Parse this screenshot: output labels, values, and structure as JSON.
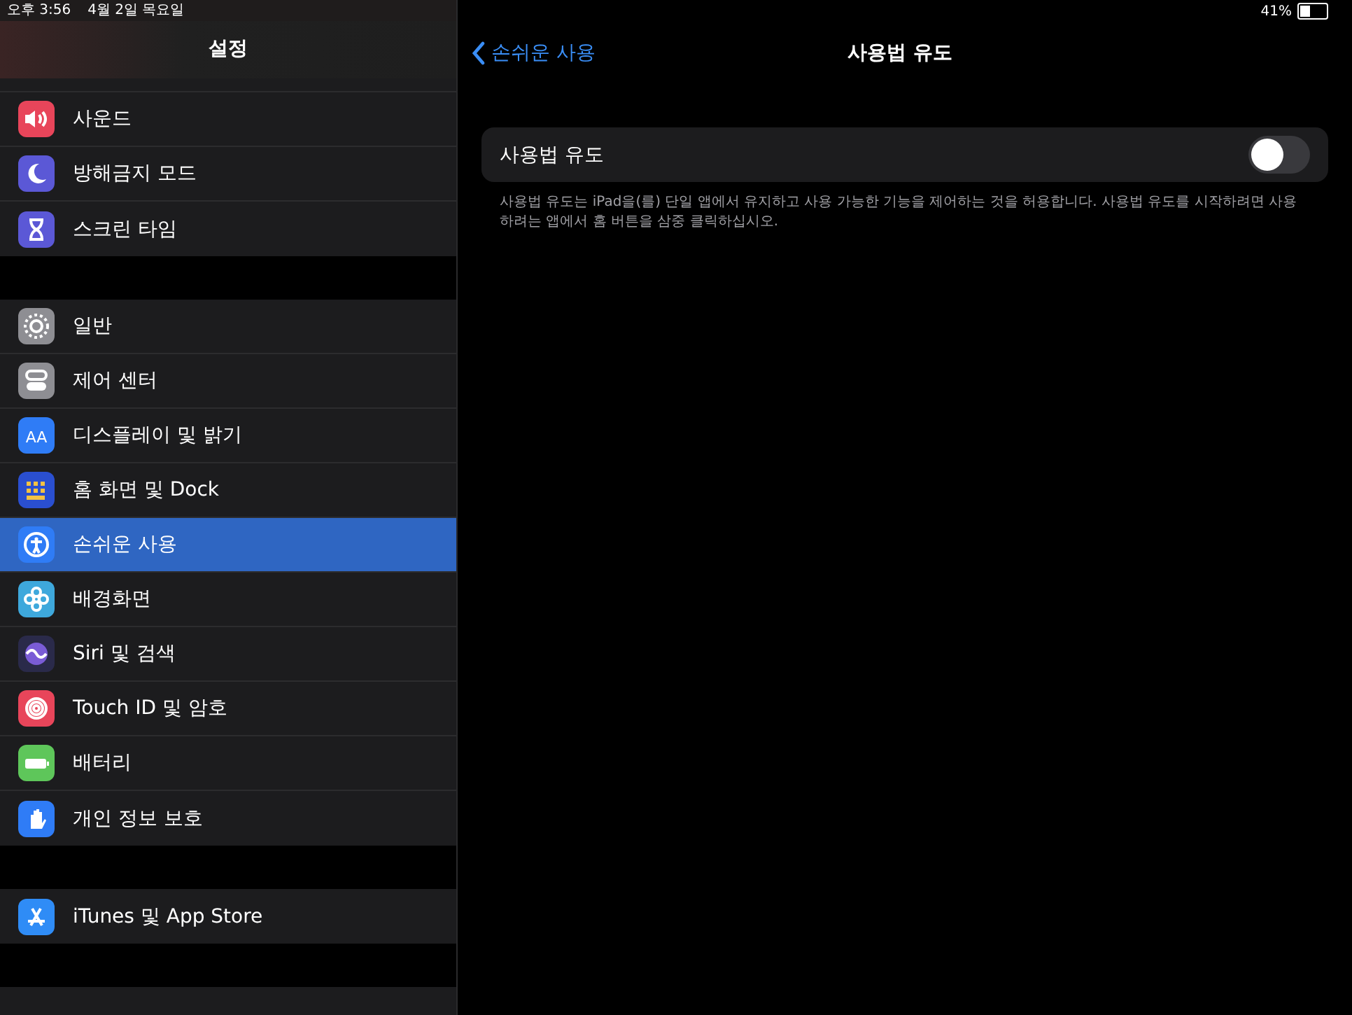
{
  "status_bar": {
    "time": "오후 3:56",
    "date": "4월 2일 목요일",
    "battery_percent": "41%"
  },
  "sidebar": {
    "title": "설정",
    "groups": [
      {
        "items": [
          {
            "label": "사운드",
            "color": "#e8455a",
            "selected": false
          },
          {
            "label": "방해금지 모드",
            "color": "#5b58d6",
            "selected": false
          },
          {
            "label": "스크린 타임",
            "color": "#5b58d6",
            "selected": false
          }
        ]
      },
      {
        "items": [
          {
            "label": "일반",
            "color": "#8e8e93",
            "selected": false
          },
          {
            "label": "제어 센터",
            "color": "#8e8e93",
            "selected": false
          },
          {
            "label": "디스플레이 및 밝기",
            "color": "#2f7cf6",
            "selected": false,
            "icon_text": "AA"
          },
          {
            "label": "홈 화면 및 Dock",
            "color": "#2a4fd0",
            "selected": false
          },
          {
            "label": "손쉬운 사용",
            "color": "#2f7cf6",
            "selected": true
          },
          {
            "label": "배경화면",
            "color": "#3ea8dc",
            "selected": false
          },
          {
            "label": "Siri 및 검색",
            "color": "#2a2a4a",
            "selected": false
          },
          {
            "label": "Touch ID 및 암호",
            "color": "#e8455a",
            "selected": false
          },
          {
            "label": "배터리",
            "color": "#5ec65a",
            "selected": false
          },
          {
            "label": "개인 정보 보호",
            "color": "#2f7cf6",
            "selected": false
          }
        ]
      },
      {
        "items": [
          {
            "label": "iTunes 및 App Store",
            "color": "#2f8cf6",
            "selected": false
          }
        ]
      }
    ]
  },
  "detail": {
    "back": "손쉬운 사용",
    "title": "사용법 유도",
    "setting": {
      "label": "사용법 유도",
      "on": false
    },
    "footer": "사용법 유도는 iPad을(를) 단일 앱에서 유지하고 사용 가능한 기능을 제어하는 것을 허용합니다. 사용법 유도를 시작하려면 사용하려는 앱에서 홈 버튼을 삼중 클릭하십시오."
  }
}
